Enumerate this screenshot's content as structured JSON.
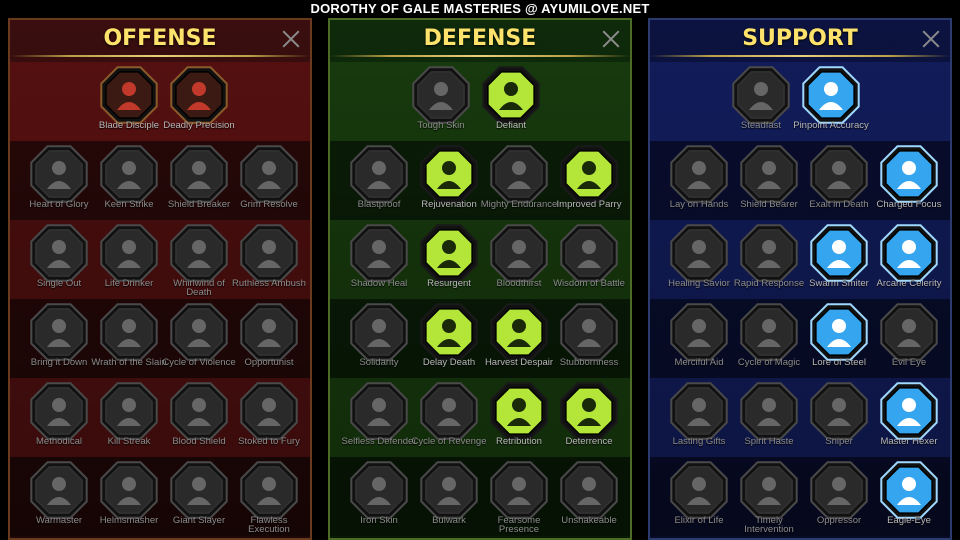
{
  "page_title": "DOROTHY OF GALE MASTERIES @ AYUMILOVE.NET",
  "colors": {
    "title_gold": "#fde36b",
    "offense_active_glow": "#c0392b",
    "defense_active": "#b4e63a",
    "support_active": "#35a5ef",
    "inactive": "#2a2a2a"
  },
  "panels": [
    {
      "key": "offense",
      "title": "OFFENSE",
      "rows": [
        [
          {
            "label": "Blade Disciple",
            "active": true,
            "icon": "crossed-swords-icon"
          },
          {
            "label": "Deadly Precision",
            "active": true,
            "icon": "crossed-daggers-icon"
          }
        ],
        [
          {
            "label": "Heart of Glory",
            "active": false,
            "icon": "horned-helm-icon"
          },
          {
            "label": "Keen Strike",
            "active": false,
            "icon": "slash-marks-icon"
          },
          {
            "label": "Shield Breaker",
            "active": false,
            "icon": "broken-shield-icon"
          },
          {
            "label": "Grim Resolve",
            "active": false,
            "icon": "hands-heart-icon"
          }
        ],
        [
          {
            "label": "Single Out",
            "active": false,
            "icon": "pointing-fist-icon"
          },
          {
            "label": "Life Drinker",
            "active": false,
            "icon": "fanged-mouth-icon"
          },
          {
            "label": "Whirlwind of Death",
            "active": false,
            "icon": "skull-whirl-icon"
          },
          {
            "label": "Ruthless Ambush",
            "active": false,
            "icon": "dagger-hand-icon"
          }
        ],
        [
          {
            "label": "Bring it Down",
            "active": false,
            "icon": "target-heart-icon"
          },
          {
            "label": "Wrath of the Slain",
            "active": false,
            "icon": "raised-fist-icon"
          },
          {
            "label": "Cycle of Violence",
            "active": false,
            "icon": "axe-icon"
          },
          {
            "label": "Opportunist",
            "active": false,
            "icon": "chain-lightning-icon"
          }
        ],
        [
          {
            "label": "Methodical",
            "active": false,
            "icon": "spider-icon"
          },
          {
            "label": "Kill Streak",
            "active": false,
            "icon": "skull-icon"
          },
          {
            "label": "Blood Shield",
            "active": false,
            "icon": "sword-shield-icon"
          },
          {
            "label": "Stoked to Fury",
            "active": false,
            "icon": "fury-figure-icon"
          }
        ],
        [
          {
            "label": "Warmaster",
            "active": false,
            "icon": "sword-figure-icon"
          },
          {
            "label": "Helmsmasher",
            "active": false,
            "icon": "knight-helm-icon"
          },
          {
            "label": "Giant Slayer",
            "active": false,
            "icon": "giant-icon"
          },
          {
            "label": "Flawless Execution",
            "active": false,
            "icon": "skull-sparks-icon"
          }
        ]
      ]
    },
    {
      "key": "defense",
      "title": "DEFENSE",
      "rows": [
        [
          {
            "label": "Tough Skin",
            "active": false,
            "icon": "scales-icon"
          },
          {
            "label": "Defiant",
            "active": true,
            "icon": "fist-icon"
          }
        ],
        [
          {
            "label": "Blastproof",
            "active": false,
            "icon": "chevron-shield-icon"
          },
          {
            "label": "Rejuvenation",
            "active": true,
            "icon": "heart-hand-icon"
          },
          {
            "label": "Mighty Endurance",
            "active": false,
            "icon": "muscle-figure-icon"
          },
          {
            "label": "Improved Parry",
            "active": true,
            "icon": "parry-blades-icon"
          }
        ],
        [
          {
            "label": "Shadow Heal",
            "active": false,
            "icon": "shadow-figure-icon"
          },
          {
            "label": "Resurgent",
            "active": true,
            "icon": "knight-shield-icon"
          },
          {
            "label": "Bloodthirst",
            "active": false,
            "icon": "blood-heart-icon"
          },
          {
            "label": "Wisdom of Battle",
            "active": false,
            "icon": "hooded-face-icon"
          }
        ],
        [
          {
            "label": "Solidarity",
            "active": false,
            "icon": "raised-hands-icon"
          },
          {
            "label": "Delay Death",
            "active": true,
            "icon": "hourglass-icon"
          },
          {
            "label": "Harvest Despair",
            "active": true,
            "icon": "open-hand-icon"
          },
          {
            "label": "Stubbornness",
            "active": false,
            "icon": "bull-icon"
          }
        ],
        [
          {
            "label": "Selfless Defender",
            "active": false,
            "icon": "defender-icon"
          },
          {
            "label": "Cycle of Revenge",
            "active": false,
            "icon": "claws-icon"
          },
          {
            "label": "Retribution",
            "active": true,
            "icon": "flaming-skull-icon"
          },
          {
            "label": "Deterrence",
            "active": true,
            "icon": "swift-hand-icon"
          }
        ],
        [
          {
            "label": "Iron Skin",
            "active": false,
            "icon": "armored-figure-icon"
          },
          {
            "label": "Bulwark",
            "active": false,
            "icon": "tower-shield-icon"
          },
          {
            "label": "Fearsome Presence",
            "active": false,
            "icon": "demon-face-icon"
          },
          {
            "label": "Unshakeable",
            "active": false,
            "icon": "strong-figure-icon"
          }
        ]
      ]
    },
    {
      "key": "support",
      "title": "SUPPORT",
      "rows": [
        [
          {
            "label": "Steadfast",
            "active": false,
            "icon": "cross-heart-icon"
          },
          {
            "label": "Pinpoint Accuracy",
            "active": true,
            "icon": "bullseye-icon"
          }
        ],
        [
          {
            "label": "Lay on Hands",
            "active": false,
            "icon": "praying-hands-icon"
          },
          {
            "label": "Shield Bearer",
            "active": false,
            "icon": "round-shield-icon"
          },
          {
            "label": "Exalt in Death",
            "active": false,
            "icon": "smoking-skull-icon"
          },
          {
            "label": "Charged Focus",
            "active": true,
            "icon": "energy-hand-icon"
          }
        ],
        [
          {
            "label": "Healing Savior",
            "active": false,
            "icon": "healer-icon"
          },
          {
            "label": "Rapid Response",
            "active": false,
            "icon": "lightning-shield-icon"
          },
          {
            "label": "Swarm Smiter",
            "active": true,
            "icon": "swarm-icon"
          },
          {
            "label": "Arcane Celerity",
            "active": true,
            "icon": "figures-icon"
          }
        ],
        [
          {
            "label": "Merciful Aid",
            "active": false,
            "icon": "chained-heart-icon"
          },
          {
            "label": "Cycle of Magic",
            "active": false,
            "icon": "comet-icon"
          },
          {
            "label": "Lore of Steel",
            "active": true,
            "icon": "open-book-icon"
          },
          {
            "label": "Evil Eye",
            "active": false,
            "icon": "spiky-eye-icon"
          }
        ],
        [
          {
            "label": "Lasting Gifts",
            "active": false,
            "icon": "compass-star-icon"
          },
          {
            "label": "Spirit Haste",
            "active": false,
            "icon": "winged-boot-icon"
          },
          {
            "label": "Sniper",
            "active": false,
            "icon": "eye-icon"
          },
          {
            "label": "Master Hexer",
            "active": true,
            "icon": "hexer-icon"
          }
        ],
        [
          {
            "label": "Elixir of Life",
            "active": false,
            "icon": "potion-icon"
          },
          {
            "label": "Timely Intervention",
            "active": false,
            "icon": "grinning-skull-icon"
          },
          {
            "label": "Oppressor",
            "active": false,
            "icon": "gauntlet-icon"
          },
          {
            "label": "Eagle-Eye",
            "active": true,
            "icon": "eagle-icon"
          }
        ]
      ]
    }
  ]
}
